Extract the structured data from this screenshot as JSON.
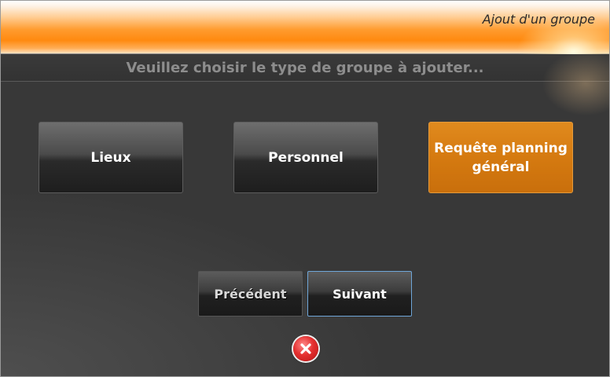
{
  "window": {
    "title": "Ajout d'un groupe"
  },
  "header": {
    "prompt": "Veuillez choisir le type de groupe à ajouter..."
  },
  "group_types": [
    {
      "label": "Lieux",
      "selected": false
    },
    {
      "label": "Personnel",
      "selected": false
    },
    {
      "label": "Requête planning général",
      "selected": true
    }
  ],
  "navigation": {
    "previous_label": "Précédent",
    "previous_enabled": false,
    "next_label": "Suivant"
  },
  "close_icon": "close-red-circle-x-icon",
  "colors": {
    "accent": "#d57a10",
    "background": "#383838",
    "title_orange": "#ff8a10",
    "focus_border": "#6fa6d8"
  }
}
